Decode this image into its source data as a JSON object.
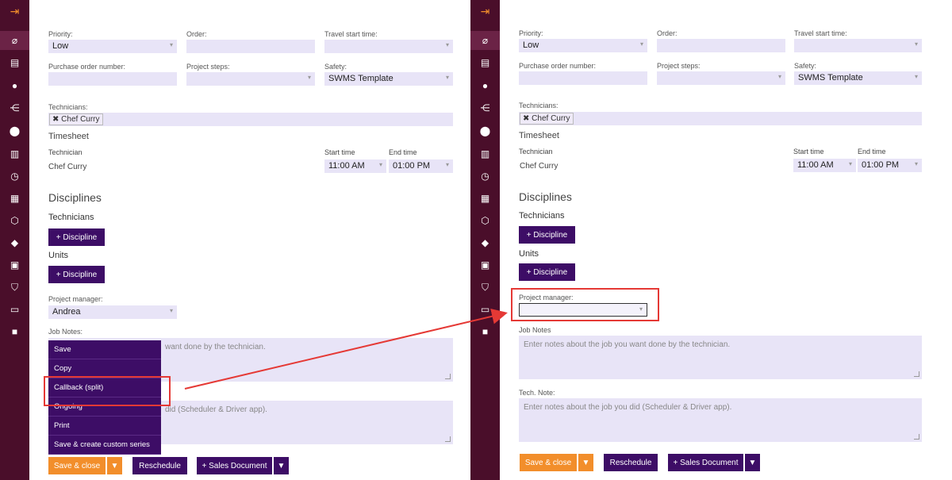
{
  "form": {
    "priority_label": "Priority:",
    "priority_value": "Low",
    "order_label": "Order:",
    "travel_label": "Travel start time:",
    "po_label": "Purchase order number:",
    "steps_label": "Project steps:",
    "safety_label": "Safety:",
    "safety_value": "SWMS Template",
    "technicians_label": "Technicians:",
    "technician_tag": "Chef Curry",
    "timesheet_title": "Timesheet",
    "col_technician": "Technician",
    "col_start": "Start time",
    "col_end": "End time",
    "row_name": "Chef Curry",
    "row_start": "11:00 AM",
    "row_end": "01:00 PM",
    "disciplines_title": "Disciplines",
    "technicians_sub": "Technicians",
    "units_sub": "Units",
    "add_discipline": "+ Discipline",
    "pm_label": "Project manager:",
    "pm_value_left": "Andrea",
    "pm_value_right": "",
    "job_notes_label_left": "Job Notes:",
    "job_notes_label_right": "Job Notes",
    "job_notes_placeholder_partial": "want done by the technician.",
    "job_notes_placeholder": "Enter notes about the job you want done by the technician.",
    "tech_note_label": "Tech. Note:",
    "tech_note_placeholder_partial": "did (Scheduler & Driver app).",
    "tech_note_placeholder": "Enter notes about the job you did (Scheduler & Driver app)."
  },
  "menu": {
    "items": [
      "Save",
      "Copy",
      "Callback (split)",
      "Ongoing",
      "Print",
      "Save & create custom series"
    ]
  },
  "actions": {
    "save_close": "Save & close",
    "reschedule": "Reschedule",
    "sales_document": "+ Sales Document"
  },
  "sidebar": {
    "icons": [
      "exit-icon",
      "tag-icon",
      "document-icon",
      "user-icon",
      "share-icon",
      "location-icon",
      "map-icon",
      "clock-icon",
      "clipboard-icon",
      "box-icon",
      "label-icon",
      "scan-icon",
      "shield-icon",
      "book-icon",
      "notebook-icon"
    ]
  },
  "colors": {
    "sidebar": "#4a0e2a",
    "primary_button": "#3d0d66",
    "accent": "#f28e2b",
    "field": "#e8e4f7",
    "highlight": "#e53935"
  }
}
